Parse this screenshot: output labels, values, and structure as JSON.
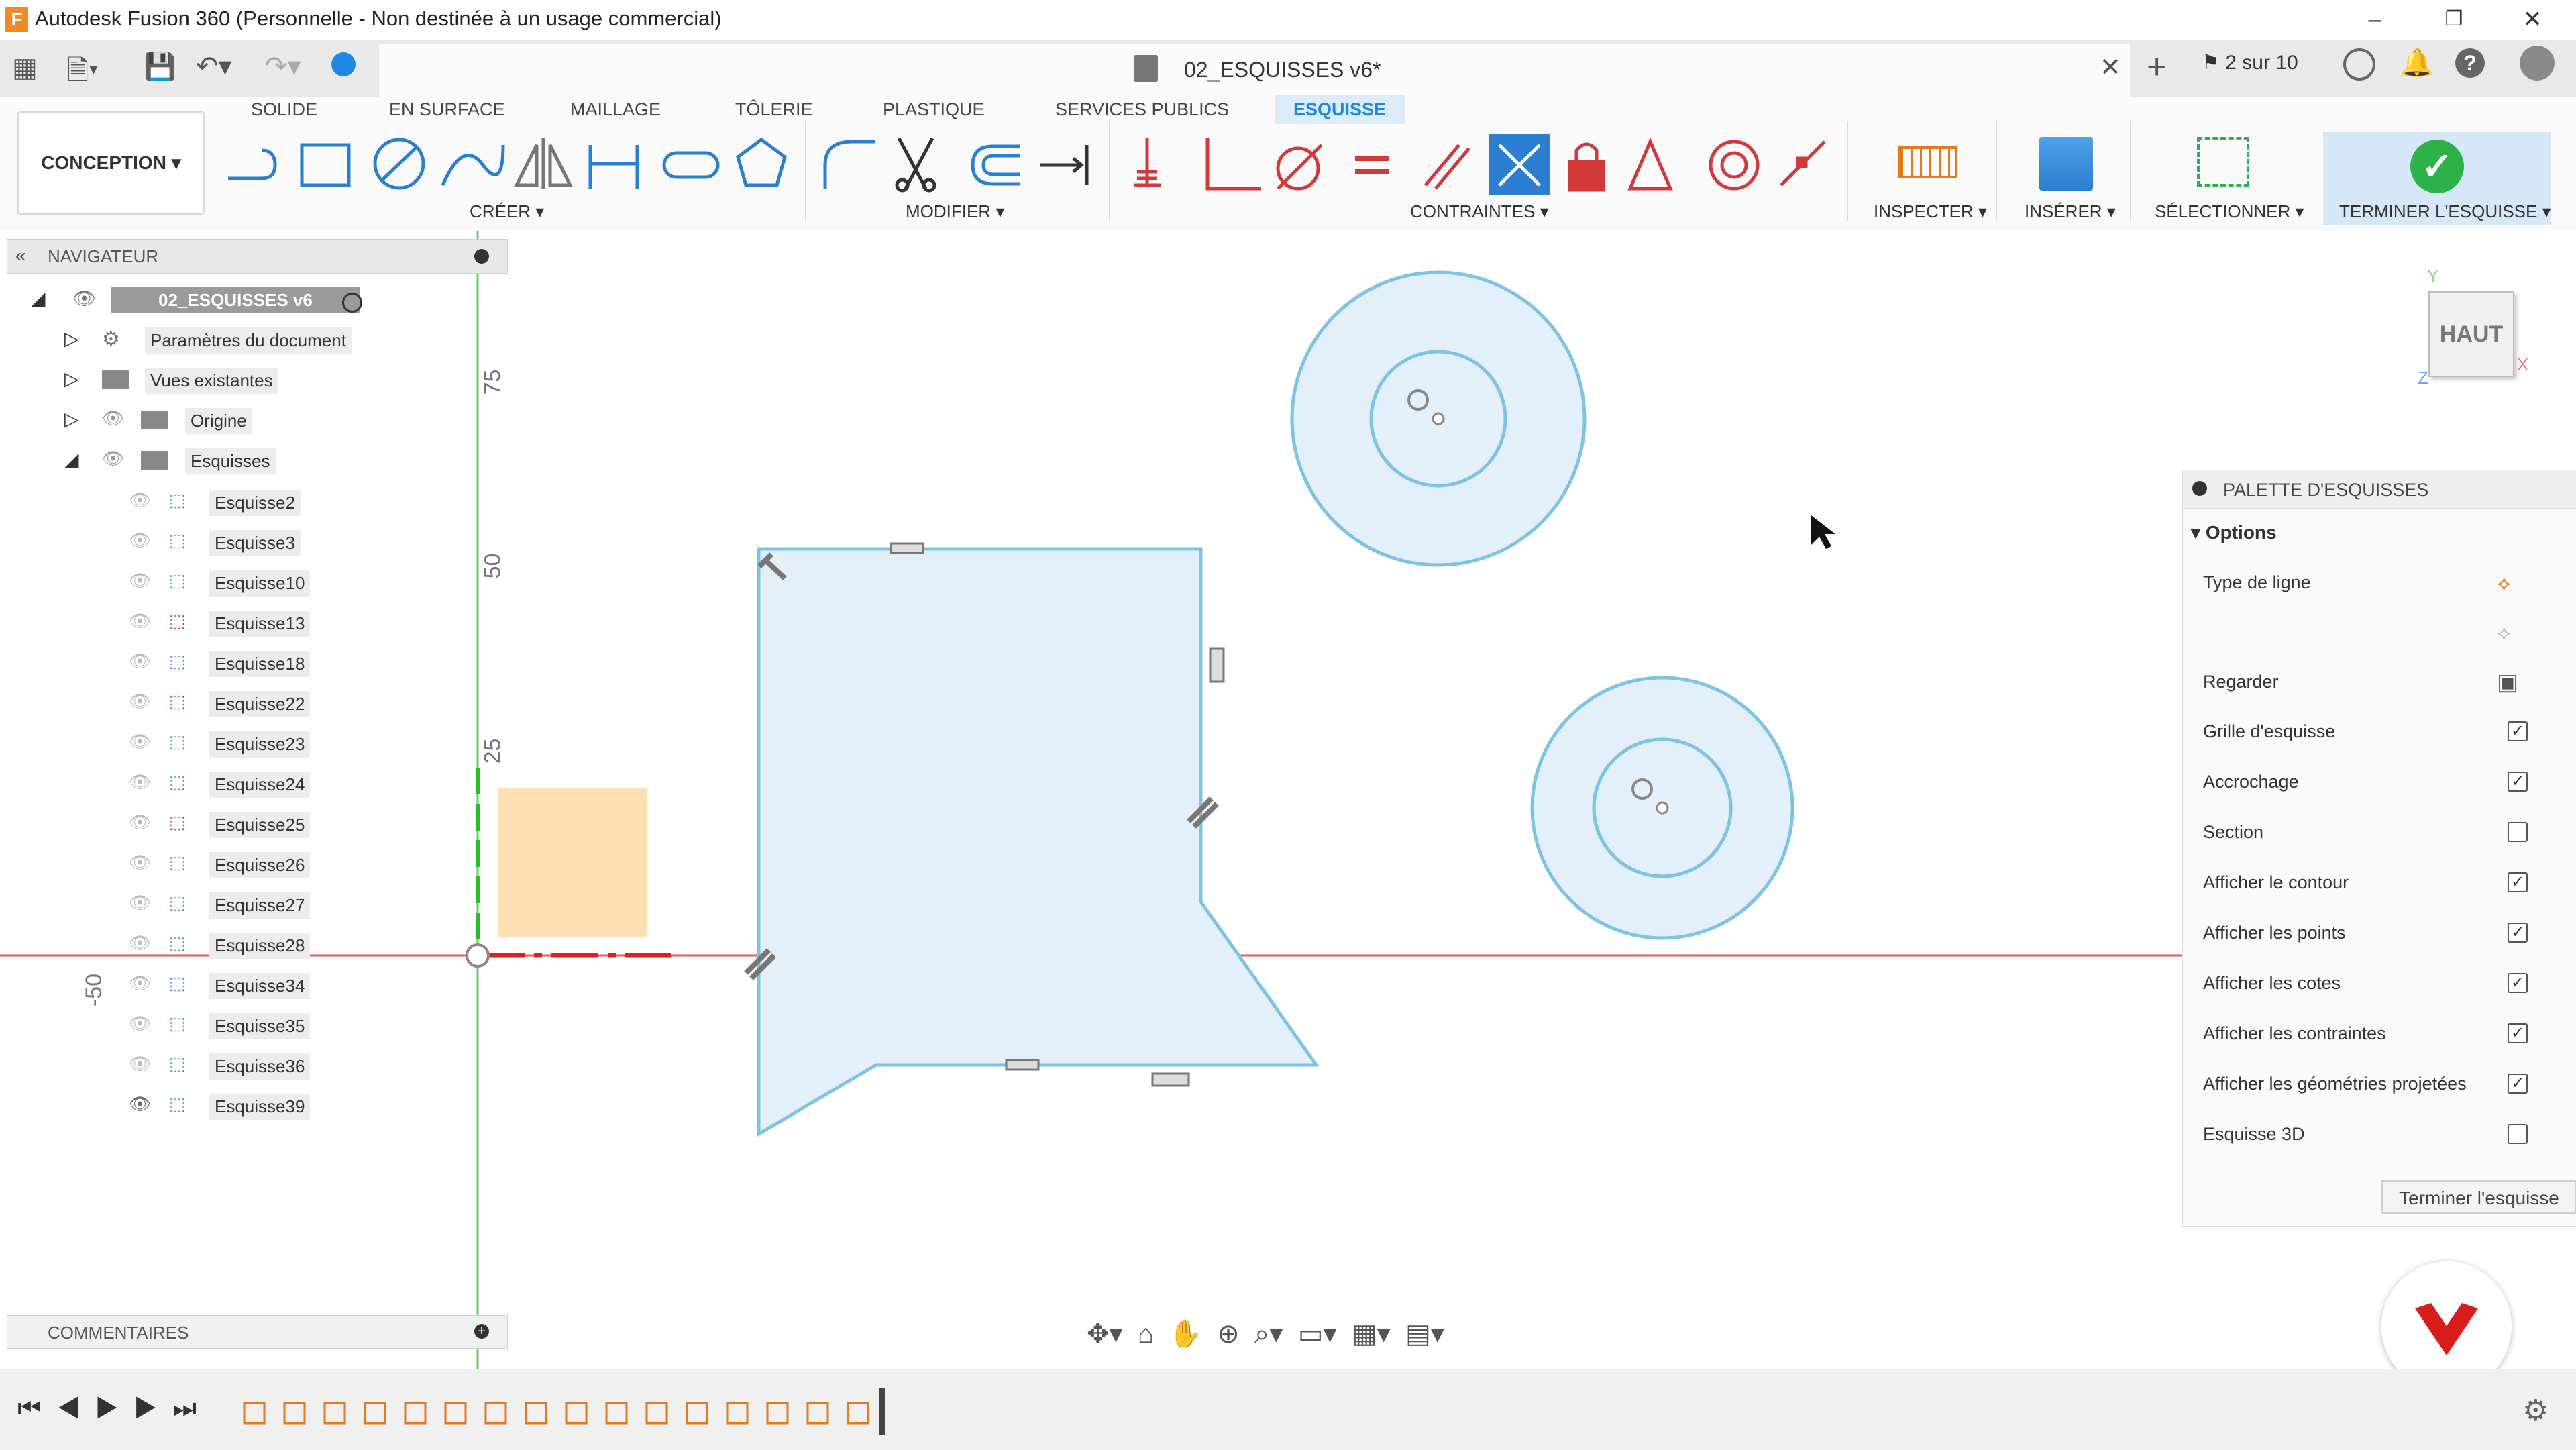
{
  "window": {
    "title": "Autodesk Fusion 360 (Personnelle - Non destinée à un usage commercial)",
    "logo_letter": "F"
  },
  "tabs": {
    "document": "02_ESQUISSES v6*",
    "job_status": "2 sur 10"
  },
  "workspace": {
    "mode": "CONCEPTION ▾",
    "tabs": [
      "SOLIDE",
      "EN SURFACE",
      "MAILLAGE",
      "TÔLERIE",
      "PLASTIQUE",
      "SERVICES PUBLICS",
      "ESQUISSE"
    ],
    "active_tab": "ESQUISSE",
    "groups": {
      "creer": "CRÉER ▾",
      "modifier": "MODIFIER ▾",
      "contraintes": "CONTRAINTES ▾",
      "inspecter": "INSPECTER ▾",
      "inserer": "INSÉRER ▾",
      "selectionner": "SÉLECTIONNER ▾",
      "terminer": "TERMINER L'ESQUISSE ▾"
    }
  },
  "navigator": {
    "title": "NAVIGATEUR",
    "root": "02_ESQUISSES v6",
    "items": [
      {
        "label": "Paramètres du document"
      },
      {
        "label": "Vues existantes"
      },
      {
        "label": "Origine"
      },
      {
        "label": "Esquisses"
      }
    ],
    "sketches": [
      "Esquisse2",
      "Esquisse3",
      "Esquisse10",
      "Esquisse13",
      "Esquisse18",
      "Esquisse22",
      "Esquisse23",
      "Esquisse24",
      "Esquisse25",
      "Esquisse26",
      "Esquisse27",
      "Esquisse28",
      "Esquisse34",
      "Esquisse35",
      "Esquisse36",
      "Esquisse39"
    ]
  },
  "rulers": {
    "v75": "75",
    "v50": "50",
    "v25": "25",
    "hm50": "-50"
  },
  "viewcube": {
    "face": "HAUT",
    "axis_x": "X",
    "axis_y": "Y",
    "axis_z": "Z"
  },
  "palette": {
    "title": "PALETTE D'ESQUISSES",
    "section": "Options",
    "rows": [
      {
        "label": "Type de ligne",
        "kind": "icon"
      },
      {
        "label": "",
        "kind": "icon"
      },
      {
        "label": "Regarder",
        "kind": "icon"
      },
      {
        "label": "Grille d'esquisse",
        "checked": "✓"
      },
      {
        "label": "Accrochage",
        "checked": "✓"
      },
      {
        "label": "Section",
        "checked": ""
      },
      {
        "label": "Afficher le contour",
        "checked": "✓"
      },
      {
        "label": "Afficher les points",
        "checked": "✓"
      },
      {
        "label": "Afficher les cotes",
        "checked": "✓"
      },
      {
        "label": "Afficher les contraintes",
        "checked": "✓"
      },
      {
        "label": "Afficher les géométries projetées",
        "checked": "✓"
      },
      {
        "label": "Esquisse 3D",
        "checked": ""
      }
    ],
    "finish_button": "Terminer l'esquisse"
  },
  "comments": {
    "title": "COMMENTAIRES"
  },
  "colors": {
    "accent": "#1e88e5",
    "sketch_fill": "#e3f0fa",
    "sketch_stroke": "#7cc3e6",
    "axis_red": "#e35a5a",
    "axis_green": "#5fcf5f",
    "orange_rect": "#fde0b3",
    "check_green": "#2db24a"
  }
}
